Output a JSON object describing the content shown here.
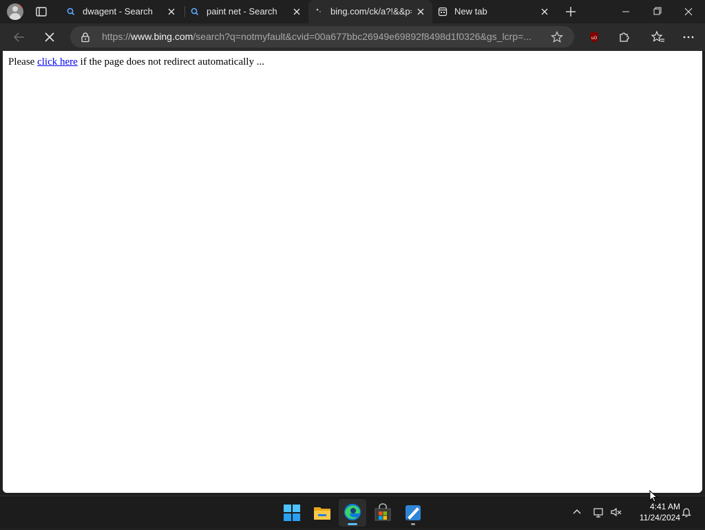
{
  "tabs": [
    {
      "title": "dwagent - Search",
      "favicon": "bing-search-icon",
      "active": false
    },
    {
      "title": "paint net - Search",
      "favicon": "bing-search-icon",
      "active": false
    },
    {
      "title": "bing.com/ck/a?!&&p=",
      "favicon": "loading-spinner-icon",
      "active": true
    },
    {
      "title": "New tab",
      "favicon": "new-tab-page-icon",
      "active": false
    }
  ],
  "toolbar": {
    "url_prefix": "https://",
    "url_host": "www.bing.com",
    "url_rest": "/search?q=notmyfault&cvid=00a677bbc26949e69892f8498d1f0326&gs_lcrp=..."
  },
  "page": {
    "text_before": "Please ",
    "link_text": "click here",
    "text_after": " if the page does not redirect automatically ..."
  },
  "taskbar": {
    "apps": [
      "windows-start-icon",
      "file-explorer-icon",
      "edge-icon",
      "microsoft-store-icon",
      "paint-net-icon"
    ],
    "time": "4:41 AM",
    "date": "11/24/2024"
  },
  "colors": {
    "browser_chrome": "#202020",
    "toolbar": "#2b2b2b",
    "address_bar": "#3b3b3b",
    "link": "#0000ee",
    "taskbar": "#1c1c1c",
    "ublock_red": "#800000"
  }
}
